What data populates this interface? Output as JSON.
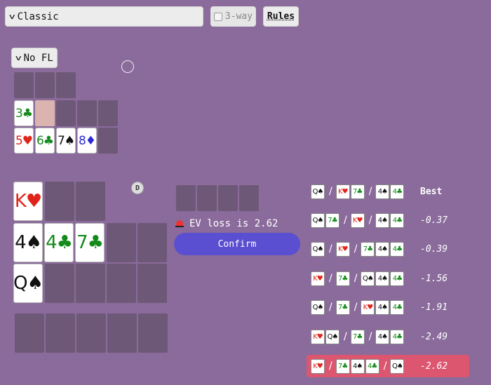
{
  "game_mode": {
    "selected": "Classic"
  },
  "three_way": {
    "label": "3-way",
    "checked": false
  },
  "rules_label": "Rules",
  "fl_select": {
    "selected": "No FL"
  },
  "dealer_label": "D",
  "ev_loss_text": "EV loss is 2.62",
  "confirm_label": "Confirm",
  "board_top": {
    "row2": [
      {
        "rank": "3",
        "suit": "♣",
        "color": "green"
      }
    ],
    "row3": [
      {
        "rank": "5",
        "suit": "♥",
        "color": "red"
      },
      {
        "rank": "6",
        "suit": "♣",
        "color": "green"
      },
      {
        "rank": "7",
        "suit": "♠",
        "color": "black"
      },
      {
        "rank": "8",
        "suit": "♦",
        "color": "blue"
      }
    ]
  },
  "hand": {
    "top": [
      {
        "rank": "K",
        "suit": "♥",
        "color": "red"
      }
    ],
    "middle": [
      {
        "rank": "4",
        "suit": "♠",
        "color": "black"
      },
      {
        "rank": "4",
        "suit": "♣",
        "color": "green"
      },
      {
        "rank": "7",
        "suit": "♣",
        "color": "green"
      }
    ],
    "bottom": [
      {
        "rank": "Q",
        "suit": "♠",
        "color": "black"
      }
    ]
  },
  "options": [
    {
      "groups": [
        [
          "Q♠"
        ],
        [
          "K♥",
          "7♣"
        ],
        [
          "4♠",
          "4♣"
        ]
      ],
      "value": "Best",
      "best": true,
      "highlight": false
    },
    {
      "groups": [
        [
          "Q♠",
          "7♣"
        ],
        [
          "K♥"
        ],
        [
          "4♠",
          "4♣"
        ]
      ],
      "value": "-0.37",
      "best": false,
      "highlight": false
    },
    {
      "groups": [
        [
          "Q♠"
        ],
        [
          "K♥"
        ],
        [
          "7♣",
          "4♠",
          "4♣"
        ]
      ],
      "value": "-0.39",
      "best": false,
      "highlight": false
    },
    {
      "groups": [
        [
          "K♥"
        ],
        [
          "7♣"
        ],
        [
          "Q♠",
          "4♠",
          "4♣"
        ]
      ],
      "value": "-1.56",
      "best": false,
      "highlight": false
    },
    {
      "groups": [
        [
          "Q♠"
        ],
        [
          "7♣"
        ],
        [
          "K♥",
          "4♠",
          "4♣"
        ]
      ],
      "value": "-1.91",
      "best": false,
      "highlight": false
    },
    {
      "groups": [
        [
          "K♥",
          "Q♠"
        ],
        [
          "7♣"
        ],
        [
          "4♠",
          "4♣"
        ]
      ],
      "value": "-2.49",
      "best": false,
      "highlight": false
    },
    {
      "groups": [
        [
          "K♥"
        ],
        [
          "7♣",
          "4♠",
          "4♣"
        ],
        [
          "Q♠"
        ]
      ],
      "value": "-2.62",
      "best": false,
      "highlight": true
    }
  ],
  "colors": {
    "background": "#8a6b9b",
    "confirm": "#5a4fd0",
    "highlight_row": "#dc5670"
  }
}
